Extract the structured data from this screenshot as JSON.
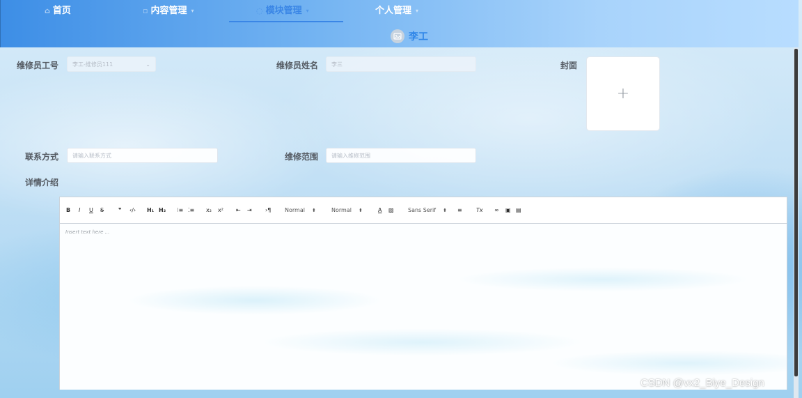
{
  "nav": {
    "items": [
      {
        "label": "首页",
        "icon": "home-icon"
      },
      {
        "label": "内容管理",
        "icon": "document-icon"
      },
      {
        "label": "模块管理",
        "icon": "module-icon"
      },
      {
        "label": "个人管理",
        "icon": ""
      }
    ],
    "active_index": 2,
    "user_name": "李工"
  },
  "form": {
    "worker_id_label": "维修员工号",
    "worker_id_value": "李工-维修员111",
    "worker_name_label": "维修员姓名",
    "worker_name_value": "李三",
    "cover_label": "封面",
    "contact_label": "联系方式",
    "contact_placeholder": "请输入联系方式",
    "scope_label": "维修范围",
    "scope_placeholder": "请输入维修范围",
    "detail_label": "详情介绍"
  },
  "editor": {
    "header_picker_1": "Normal",
    "header_picker_2": "Normal",
    "font_picker": "Sans Serif",
    "placeholder": "Insert text here ..."
  },
  "watermark": "CSDN @vx2_Biye_Design",
  "colors": {
    "accent": "#3a86e6",
    "nav_gradient_start": "#3d8ee6",
    "nav_gradient_end": "#b8ddff"
  }
}
